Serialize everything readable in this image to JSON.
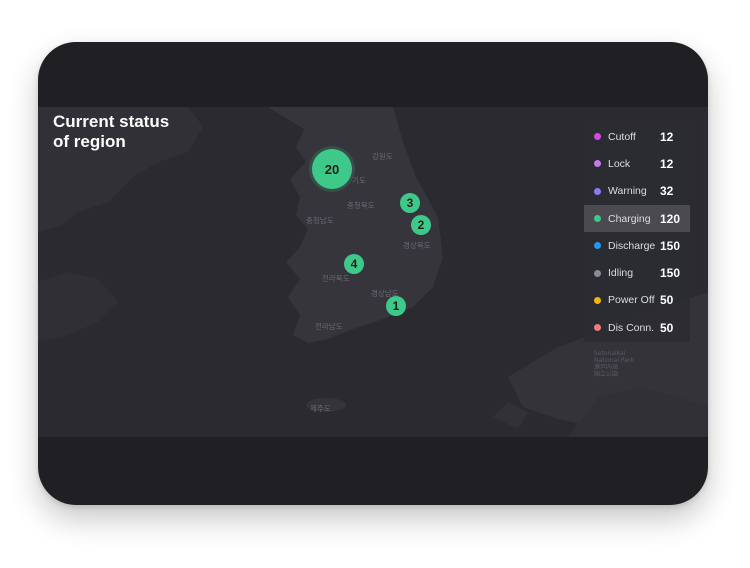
{
  "title": {
    "line1": "Current status",
    "line2": "of region"
  },
  "colors": {
    "marker": "#3ec98a",
    "background": "#202024",
    "map": "#2a2a30"
  },
  "markers": [
    {
      "id": "cluster-20",
      "count": "20"
    },
    {
      "id": "cluster-3",
      "count": "3"
    },
    {
      "id": "cluster-2",
      "count": "2"
    },
    {
      "id": "cluster-4",
      "count": "4"
    },
    {
      "id": "cluster-1",
      "count": "1"
    }
  ],
  "regions": {
    "gangwon": "강원도",
    "gyeonggi": "기도",
    "chungbuk": "충청북도",
    "chungnam": "충청남도",
    "gyeongbuk": "경상북도",
    "jeonbuk": "전라북도",
    "gyeongnam": "경상남도",
    "jeonnam": "전라남도",
    "jeju": "제주도",
    "setonaikai": "Setonaikai\nNational Park\n瀬戸内海\n国立公園"
  },
  "legend": [
    {
      "label": "Cutoff",
      "count": "12",
      "color": "#d946ef",
      "active": false
    },
    {
      "label": "Lock",
      "count": "12",
      "color": "#c778f0",
      "active": false
    },
    {
      "label": "Warning",
      "count": "32",
      "color": "#8b7cf6",
      "active": false
    },
    {
      "label": "Charging",
      "count": "120",
      "color": "#3ec98a",
      "active": true
    },
    {
      "label": "Discharge",
      "count": "150",
      "color": "#1e9bf0",
      "active": false
    },
    {
      "label": "Idling",
      "count": "150",
      "color": "#8a8a92",
      "active": false
    },
    {
      "label": "Power Off",
      "count": "50",
      "color": "#f5b400",
      "active": false
    },
    {
      "label": "Dis Conn.",
      "count": "50",
      "color": "#f07a7a",
      "active": false
    }
  ]
}
